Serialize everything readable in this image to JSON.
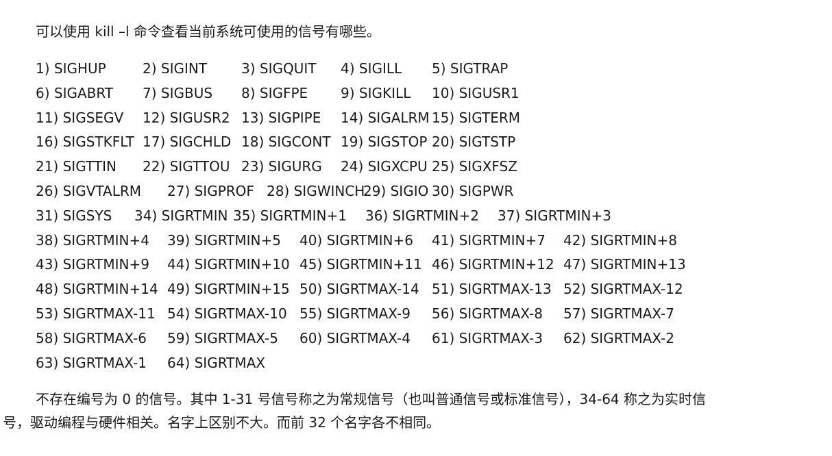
{
  "intro": "可以使用 kill –l 命令查看当前系统可使用的信号有哪些。",
  "signal_rows": [
    [
      "1) SIGHUP",
      "2) SIGINT",
      "3) SIGQUIT",
      "4) SIGILL",
      "5) SIGTRAP"
    ],
    [
      "6) SIGABRT",
      "7) SIGBUS",
      "8) SIGFPE",
      "9) SIGKILL",
      "10) SIGUSR1"
    ],
    [
      "11) SIGSEGV",
      "12) SIGUSR2",
      "13) SIGPIPE",
      "14) SIGALRM",
      "15) SIGTERM"
    ],
    [
      "16) SIGSTKFLT",
      "17) SIGCHLD",
      "18) SIGCONT",
      "19) SIGSTOP",
      "20) SIGTSTP"
    ],
    [
      "21) SIGTTIN",
      "22) SIGTTOU",
      "23) SIGURG",
      "24) SIGXCPU",
      "25) SIGXFSZ"
    ],
    [
      "26) SIGVTALRM",
      "27) SIGPROF",
      "28) SIGWINCH",
      "29) SIGIO",
      "30) SIGPWR"
    ],
    [
      "31) SIGSYS",
      "34) SIGRTMIN",
      "35) SIGRTMIN+1",
      "36) SIGRTMIN+2",
      "37) SIGRTMIN+3"
    ],
    [
      "38) SIGRTMIN+4",
      "39) SIGRTMIN+5",
      "40) SIGRTMIN+6",
      "41) SIGRTMIN+7",
      "42) SIGRTMIN+8"
    ],
    [
      "43) SIGRTMIN+9",
      "44) SIGRTMIN+10",
      "45) SIGRTMIN+11",
      "46) SIGRTMIN+12",
      "47) SIGRTMIN+13"
    ],
    [
      "48) SIGRTMIN+14",
      "49) SIGRTMIN+15",
      "50) SIGRTMAX-14",
      "51) SIGRTMAX-13",
      "52) SIGRTMAX-12"
    ],
    [
      "53) SIGRTMAX-11",
      "54) SIGRTMAX-10",
      "55) SIGRTMAX-9",
      "56) SIGRTMAX-8",
      "57) SIGRTMAX-7"
    ],
    [
      "58) SIGRTMAX-6",
      "59) SIGRTMAX-5",
      "60) SIGRTMAX-4",
      "61) SIGRTMAX-3",
      "62) SIGRTMAX-2"
    ],
    [
      "63) SIGRTMAX-1",
      "64) SIGRTMAX"
    ]
  ],
  "footer_line1": "不存在编号为 0 的信号。其中 1-31 号信号称之为常规信号（也叫普通信号或标准信号），34-64 称之为实时信",
  "footer_line2": "号，驱动编程与硬件相关。名字上区别不大。而前 32 个名字各不相同。"
}
